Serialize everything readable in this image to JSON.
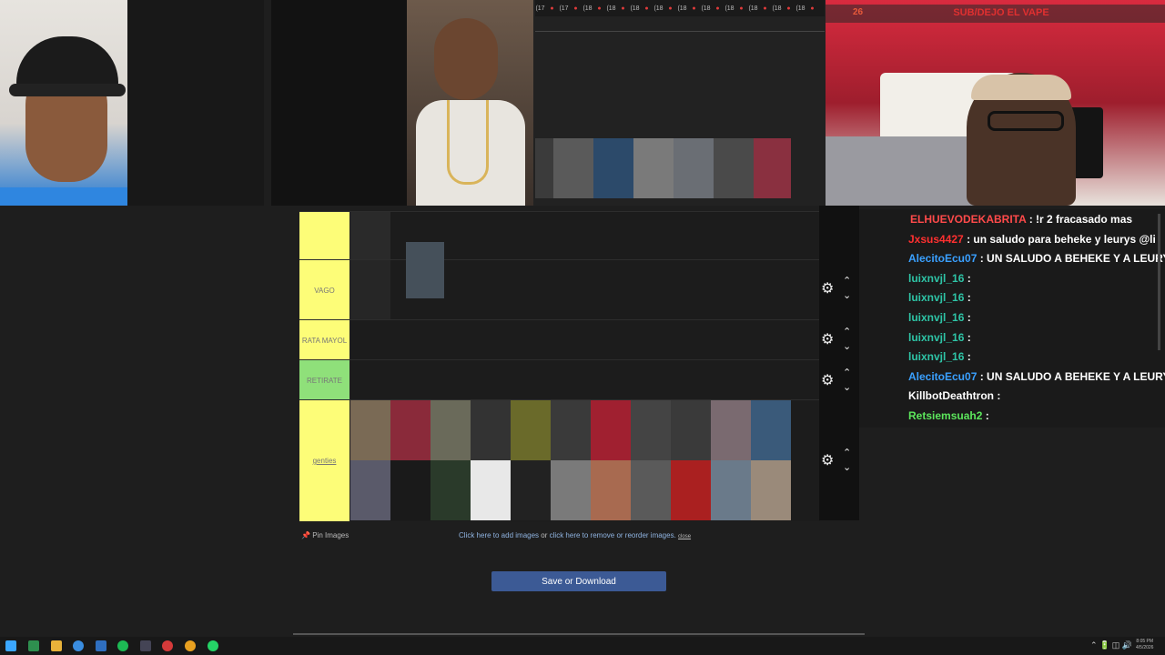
{
  "stream_banner": {
    "count": "26",
    "text": "SUB/DEJO EL VAPE"
  },
  "tabs": [
    "(17",
    "(17",
    "(18",
    "(18",
    "(18",
    "(18",
    "(18",
    "(18",
    "(18",
    "(18",
    "(18",
    "(18"
  ],
  "tiers": [
    {
      "label": "",
      "color": "#fdfd78"
    },
    {
      "label": "VAGO",
      "color": "#fdfd78"
    },
    {
      "label": "RATA MAYOL",
      "color": "#fdfd78"
    },
    {
      "label": "RETIRATE",
      "color": "#8fe07a"
    },
    {
      "label": "genties",
      "color": "#fdfd78"
    }
  ],
  "chat": [
    {
      "name": "ELHUEVODEKABRITA",
      "color": "#ff4a4a",
      "text": ": !r 2 fracasado mas"
    },
    {
      "name": "Jxsus4427",
      "color": "#ff3030",
      "text": ": un saludo para beheke y leurys @li"
    },
    {
      "name": "AlecitoEcu07",
      "color": "#3aa0ff",
      "text": ": UN SALUDO A BEHEKE Y A LEURY"
    },
    {
      "name": "luixnvjl_16",
      "color": "#2ec4a6",
      "text": ":"
    },
    {
      "name": "luixnvjl_16",
      "color": "#2ec4a6",
      "text": ":"
    },
    {
      "name": "luixnvjl_16",
      "color": "#2ec4a6",
      "text": ":"
    },
    {
      "name": "luixnvjl_16",
      "color": "#2ec4a6",
      "text": ":"
    },
    {
      "name": "luixnvjl_16",
      "color": "#2ec4a6",
      "text": ":"
    },
    {
      "name": "AlecitoEcu07",
      "color": "#3aa0ff",
      "text": ": UN SALUDO A BEHEKE Y A LEURY"
    },
    {
      "name": "KillbotDeathtron",
      "color": "#ffffff",
      "text": ":"
    },
    {
      "name": "Retsiemsuah2",
      "color": "#5ce65c",
      "text": ":"
    }
  ],
  "footer": {
    "pin": "Pin Images",
    "add": "Click here to add images",
    "or": "or",
    "remove": "click here to remove or reorder images.",
    "close": "close"
  },
  "save_button": "Save or Download",
  "taskbar": {
    "time": "8:05 PM",
    "date": "4/5/2026"
  }
}
